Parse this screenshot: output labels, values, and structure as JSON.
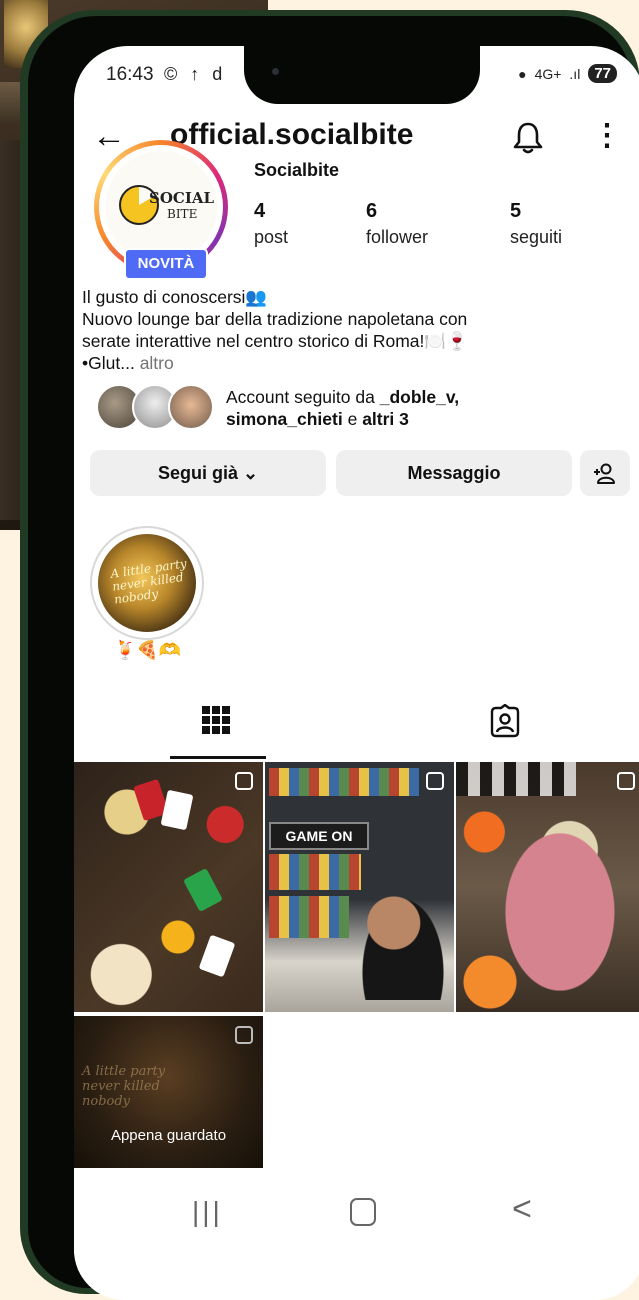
{
  "status_bar": {
    "time": "16:43",
    "left_icons": "© ↑ d",
    "network": "4G+",
    "battery": "77"
  },
  "header": {
    "back_icon": "arrow-left-icon",
    "username": "official.socialbite",
    "bell_icon": "bell-icon",
    "menu_icon": "more-vertical-icon"
  },
  "profile": {
    "display_name": "Socialbite",
    "logo_text_1": "SOCIAL",
    "logo_text_2": "BITE",
    "new_badge": "NOVITÀ",
    "stats": [
      {
        "value": "4",
        "label": "post"
      },
      {
        "value": "6",
        "label": "follower"
      },
      {
        "value": "5",
        "label": "seguiti"
      }
    ]
  },
  "bio": {
    "line1": "Il gusto di conoscersi👥",
    "line2": "Nuovo lounge bar della tradizione napoletana con",
    "line3": "serate interattive nel centro storico di Roma!🍽️🍷",
    "line4": "•Glut...",
    "more": "altro"
  },
  "followed_by": {
    "prefix": "Account seguito da",
    "user1": "_doble_v,",
    "user2": "simona_chieti",
    "conj": "e",
    "others": "altri 3"
  },
  "actions": {
    "follow_label": "Segui già ⌄",
    "message_label": "Messaggio",
    "add_person_icon": "add-person-icon"
  },
  "highlight": {
    "label": "🍹🍕🫶",
    "image_text": "A little party never killed nobody"
  },
  "tabs": {
    "grid_icon": "grid-icon",
    "tagged_icon": "tagged-person-icon"
  },
  "posts": {
    "post2_sign": "GAME ON",
    "post4_neon": "A little party never killed nobody",
    "post4_label": "Appena guardato"
  },
  "nav": {
    "recent": "|||",
    "back": "<"
  },
  "colors": {
    "badge": "#4f6bf5",
    "button_bg": "#efefef",
    "phone_frame": "#213a24",
    "page_bg": "#fdf3e0"
  }
}
